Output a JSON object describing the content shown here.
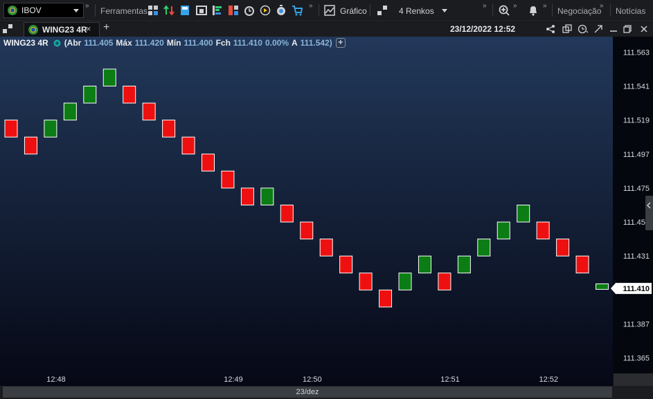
{
  "toolbar": {
    "symbol": "IBOV",
    "tools_label": "Ferramentas",
    "chart_label": "Gráfico",
    "renko_label": "4 Renkos",
    "negociacao_label": "Negociação",
    "noticias_label": "Notícias"
  },
  "tab": {
    "name": "WING23 4R",
    "datetime": "23/12/2022 12:52"
  },
  "ohlc": {
    "symbol": "WING23 4R",
    "abr_label": "(Abr",
    "abr": "111.405",
    "max_label": "Máx",
    "max": "111.420",
    "min_label": "Mín",
    "min": "111.400",
    "fch_label": "Fch",
    "fch": "111.410",
    "chg": "0.00%",
    "a_label": "A",
    "a": "111.542)"
  },
  "footer": {
    "date_label": "23/dez"
  },
  "colors": {
    "up": "#0b7d14",
    "down": "#ee1010",
    "bg_top": "#22385a",
    "bg_bottom": "#060815"
  },
  "chart_data": {
    "type": "renko",
    "brick_size": 0.011,
    "bricks": [
      {
        "open": 111.519,
        "close": 111.508,
        "dir": "down"
      },
      {
        "open": 111.508,
        "close": 111.497,
        "dir": "down"
      },
      {
        "open": 111.508,
        "close": 111.519,
        "dir": "up"
      },
      {
        "open": 111.519,
        "close": 111.53,
        "dir": "up"
      },
      {
        "open": 111.53,
        "close": 111.541,
        "dir": "up"
      },
      {
        "open": 111.541,
        "close": 111.552,
        "dir": "up"
      },
      {
        "open": 111.541,
        "close": 111.53,
        "dir": "down"
      },
      {
        "open": 111.53,
        "close": 111.519,
        "dir": "down"
      },
      {
        "open": 111.519,
        "close": 111.508,
        "dir": "down"
      },
      {
        "open": 111.508,
        "close": 111.497,
        "dir": "down"
      },
      {
        "open": 111.497,
        "close": 111.486,
        "dir": "down"
      },
      {
        "open": 111.486,
        "close": 111.475,
        "dir": "down"
      },
      {
        "open": 111.475,
        "close": 111.464,
        "dir": "down"
      },
      {
        "open": 111.464,
        "close": 111.475,
        "dir": "up"
      },
      {
        "open": 111.464,
        "close": 111.453,
        "dir": "down"
      },
      {
        "open": 111.453,
        "close": 111.442,
        "dir": "down"
      },
      {
        "open": 111.442,
        "close": 111.431,
        "dir": "down"
      },
      {
        "open": 111.431,
        "close": 111.42,
        "dir": "down"
      },
      {
        "open": 111.42,
        "close": 111.409,
        "dir": "down"
      },
      {
        "open": 111.409,
        "close": 111.398,
        "dir": "down"
      },
      {
        "open": 111.409,
        "close": 111.42,
        "dir": "up"
      },
      {
        "open": 111.42,
        "close": 111.431,
        "dir": "up"
      },
      {
        "open": 111.42,
        "close": 111.409,
        "dir": "down"
      },
      {
        "open": 111.42,
        "close": 111.431,
        "dir": "up"
      },
      {
        "open": 111.431,
        "close": 111.442,
        "dir": "up"
      },
      {
        "open": 111.442,
        "close": 111.453,
        "dir": "up"
      },
      {
        "open": 111.453,
        "close": 111.464,
        "dir": "up"
      },
      {
        "open": 111.453,
        "close": 111.442,
        "dir": "down"
      },
      {
        "open": 111.442,
        "close": 111.431,
        "dir": "down"
      },
      {
        "open": 111.431,
        "close": 111.42,
        "dir": "down"
      },
      {
        "open": 111.41,
        "close": 111.413,
        "dir": "up"
      }
    ],
    "y_ticks": [
      "111.563",
      "111.541",
      "111.519",
      "111.497",
      "111.475",
      "111.453",
      "111.431",
      "111.387",
      "111.365"
    ],
    "ylim": [
      111.355,
      111.573
    ],
    "x_ticks": [
      {
        "label": "12:48",
        "brick": 2.6
      },
      {
        "label": "12:49",
        "brick": 11.6
      },
      {
        "label": "12:50",
        "brick": 15.6
      },
      {
        "label": "12:51",
        "brick": 22.6
      },
      {
        "label": "12:52",
        "brick": 27.6
      }
    ],
    "last_price": "111.410"
  }
}
